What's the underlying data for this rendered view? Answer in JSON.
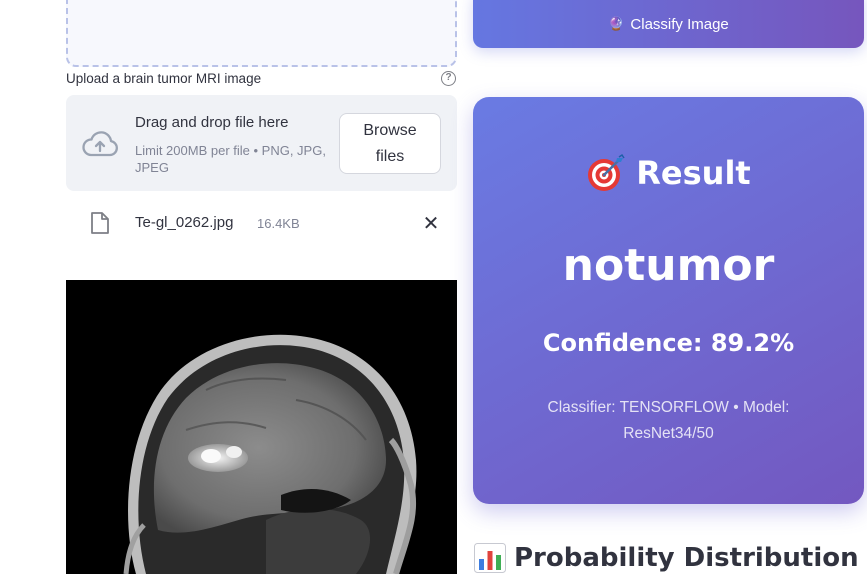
{
  "uploader": {
    "label": "Upload a brain tumor MRI image",
    "help_glyph": "?",
    "dropzone_title": "Drag and drop file here",
    "dropzone_limit": "Limit 200MB per file • PNG, JPG, JPEG",
    "browse_label": "Browse files",
    "icons": {
      "upload": "cloud-upload-icon",
      "help": "help-circle-icon"
    }
  },
  "uploaded_file": {
    "name": "Te-gl_0262.jpg",
    "size": "16.4KB",
    "remove_glyph": "✕",
    "icon": "file-icon"
  },
  "preview": {
    "icon": "mri-scan-image"
  },
  "actions": {
    "classify_label": "Classify Image",
    "classify_icon": "🔮"
  },
  "result": {
    "heading": "Result",
    "heading_icon": "target-icon",
    "prediction": "notumor",
    "confidence": "Confidence: 89.2%",
    "model_info": "Classifier: TENSORFLOW • Model: ResNet34/50"
  },
  "probability": {
    "heading": "Probability Distribution",
    "heading_icon": "bar-chart-icon"
  },
  "colors": {
    "accent_start": "#6577e1",
    "accent_end": "#7656bd",
    "text": "#31333f",
    "muted": "#808495",
    "dropzone_bg": "#f0f2f6"
  }
}
